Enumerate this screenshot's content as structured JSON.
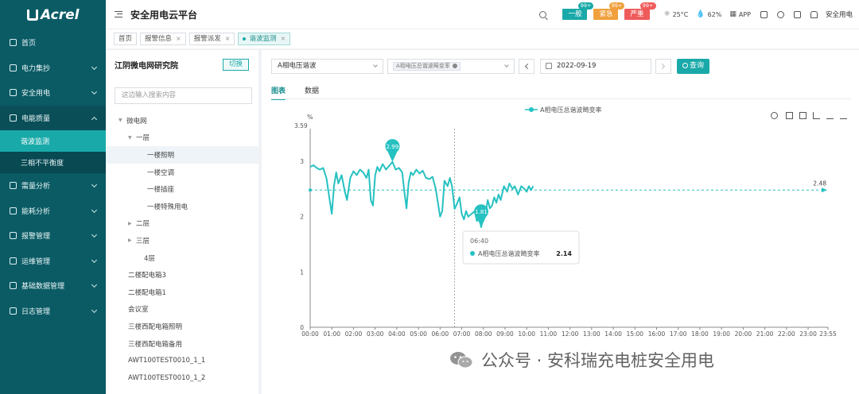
{
  "sidebar": {
    "brand": "Acrel",
    "items": [
      {
        "label": "首页",
        "icon": "home-icon"
      },
      {
        "label": "电力集抄",
        "icon": "meter-icon",
        "chevron": true
      },
      {
        "label": "安全用电",
        "icon": "flame-icon",
        "chevron": true
      },
      {
        "label": "电能质量",
        "icon": "monitor-icon",
        "chevron": true,
        "open": true
      },
      {
        "label": "需量分析",
        "icon": "trend-icon",
        "chevron": true
      },
      {
        "label": "能耗分析",
        "icon": "bar-chart-icon",
        "chevron": true
      },
      {
        "label": "报警管理",
        "icon": "alarm-icon",
        "chevron": true
      },
      {
        "label": "运维管理",
        "icon": "pulse-icon",
        "chevron": true
      },
      {
        "label": "基础数据管理",
        "icon": "database-icon",
        "chevron": true
      },
      {
        "label": "日志管理",
        "icon": "log-icon",
        "chevron": true
      }
    ],
    "sub_items": [
      {
        "label": "谐波监测",
        "active": true
      },
      {
        "label": "三相不平衡度",
        "active": false
      }
    ]
  },
  "header": {
    "title": "安全用电云平台",
    "alarms": [
      {
        "label": "一般",
        "count": "99+",
        "color": "#1aa9a9"
      },
      {
        "label": "紧急",
        "count": "99+",
        "color": "#f0a03c"
      },
      {
        "label": "严重",
        "count": "99+",
        "color": "#ef5b5b"
      }
    ],
    "temperature": "25°C",
    "humidity": "62%",
    "app_label": "APP",
    "user": "安全用电"
  },
  "tabs": [
    {
      "label": "首页",
      "closable": false,
      "active": false
    },
    {
      "label": "报警信息",
      "closable": true,
      "active": false
    },
    {
      "label": "报警派发",
      "closable": true,
      "active": false
    },
    {
      "label": "谐波监测",
      "closable": true,
      "active": true
    }
  ],
  "tree_panel": {
    "title": "江阴微电网研究院",
    "switch_label": "切换",
    "search_placeholder": "这边输入搜索内容",
    "nodes": [
      {
        "label": "微电网",
        "level": 0,
        "arrow": "down"
      },
      {
        "label": "一层",
        "level": 1,
        "arrow": "down"
      },
      {
        "label": "一楼照明",
        "level": 2,
        "selected": true
      },
      {
        "label": "一楼空调",
        "level": 2
      },
      {
        "label": "一楼插座",
        "level": 2
      },
      {
        "label": "一楼特殊用电",
        "level": 2
      },
      {
        "label": "二层",
        "level": 1,
        "arrow": "right"
      },
      {
        "label": "三层",
        "level": 1,
        "arrow": "right"
      },
      {
        "label": "4层",
        "level": 1
      },
      {
        "label": "二楼配电箱3",
        "level": -1
      },
      {
        "label": "二楼配电箱1",
        "level": -1
      },
      {
        "label": "会议室",
        "level": -1
      },
      {
        "label": "三楼西配电箱照明",
        "level": -1
      },
      {
        "label": "三楼西配电箱备用",
        "level": -1
      },
      {
        "label": "AWT100TEST0010_1_1",
        "level": -1
      },
      {
        "label": "AWT100TEST0010_1_2",
        "level": -1
      }
    ]
  },
  "toolbar": {
    "param_select": "A相电压谐波",
    "metric_chip": "A相电压总谐波畸变率",
    "date": "2022-09-19",
    "query_label": "查询"
  },
  "view_tabs": [
    {
      "label": "图表",
      "active": true
    },
    {
      "label": "数据",
      "active": false
    }
  ],
  "chart_data": {
    "type": "line",
    "legend": "A相电压总谐波畸变率",
    "y_unit": "%",
    "y_max_label": "3.59",
    "ylim": [
      0,
      3.59
    ],
    "yticks": [
      0,
      1,
      2,
      3
    ],
    "x_labels": [
      "00:00",
      "01:00",
      "02:00",
      "03:00",
      "04:00",
      "05:00",
      "06:00",
      "07:00",
      "08:00",
      "09:00",
      "10:00",
      "11:00",
      "12:00",
      "13:00",
      "14:00",
      "15:00",
      "16:00",
      "17:00",
      "18:00",
      "19:00",
      "20:00",
      "21:00",
      "22:00",
      "23:00",
      "23:55"
    ],
    "max_marker": {
      "value": "2.99",
      "time_hours": 3.8
    },
    "min_marker": {
      "value": "1.81",
      "time_hours": 7.9
    },
    "average_line": {
      "value": "2.48"
    },
    "tooltip": {
      "time": "06:40",
      "series": "A相电压总谐波畸变率",
      "value": "2.14",
      "time_hours": 6.67
    },
    "series": [
      {
        "name": "A相电压总谐波畸变率",
        "color": "#26c1c1",
        "points": [
          [
            0.0,
            2.9
          ],
          [
            0.15,
            2.93
          ],
          [
            0.3,
            2.88
          ],
          [
            0.45,
            2.85
          ],
          [
            0.6,
            2.88
          ],
          [
            0.75,
            2.7
          ],
          [
            0.9,
            2.3
          ],
          [
            1.0,
            2.05
          ],
          [
            1.1,
            2.55
          ],
          [
            1.2,
            2.8
          ],
          [
            1.3,
            2.6
          ],
          [
            1.45,
            2.75
          ],
          [
            1.6,
            2.45
          ],
          [
            1.7,
            2.3
          ],
          [
            1.85,
            2.7
          ],
          [
            2.0,
            2.82
          ],
          [
            2.15,
            2.75
          ],
          [
            2.3,
            2.85
          ],
          [
            2.45,
            2.8
          ],
          [
            2.6,
            2.7
          ],
          [
            2.7,
            2.85
          ],
          [
            2.8,
            2.3
          ],
          [
            2.9,
            2.2
          ],
          [
            3.0,
            2.75
          ],
          [
            3.1,
            2.9
          ],
          [
            3.2,
            2.82
          ],
          [
            3.35,
            2.95
          ],
          [
            3.5,
            2.85
          ],
          [
            3.65,
            2.92
          ],
          [
            3.8,
            2.99
          ],
          [
            3.95,
            2.85
          ],
          [
            4.1,
            2.88
          ],
          [
            4.25,
            2.8
          ],
          [
            4.35,
            2.45
          ],
          [
            4.45,
            2.15
          ],
          [
            4.55,
            2.62
          ],
          [
            4.65,
            2.8
          ],
          [
            4.75,
            2.75
          ],
          [
            4.9,
            2.85
          ],
          [
            5.05,
            2.78
          ],
          [
            5.2,
            2.83
          ],
          [
            5.35,
            2.7
          ],
          [
            5.5,
            2.68
          ],
          [
            5.65,
            2.72
          ],
          [
            5.8,
            2.5
          ],
          [
            5.9,
            2.25
          ],
          [
            6.0,
            2.0
          ],
          [
            6.1,
            2.1
          ],
          [
            6.2,
            2.65
          ],
          [
            6.35,
            2.55
          ],
          [
            6.45,
            2.7
          ],
          [
            6.55,
            2.55
          ],
          [
            6.67,
            2.14
          ],
          [
            6.8,
            2.25
          ],
          [
            6.9,
            2.35
          ],
          [
            7.0,
            2.05
          ],
          [
            7.1,
            1.95
          ],
          [
            7.2,
            2.1
          ],
          [
            7.3,
            2.0
          ],
          [
            7.45,
            2.05
          ],
          [
            7.6,
            2.1
          ],
          [
            7.7,
            1.92
          ],
          [
            7.8,
            2.0
          ],
          [
            7.9,
            1.81
          ],
          [
            8.0,
            2.0
          ],
          [
            8.1,
            2.05
          ],
          [
            8.2,
            2.3
          ],
          [
            8.3,
            2.15
          ],
          [
            8.4,
            2.2
          ],
          [
            8.5,
            2.35
          ],
          [
            8.6,
            2.25
          ],
          [
            8.7,
            2.4
          ],
          [
            8.8,
            2.3
          ],
          [
            8.95,
            2.55
          ],
          [
            9.1,
            2.45
          ],
          [
            9.2,
            2.6
          ],
          [
            9.35,
            2.5
          ],
          [
            9.45,
            2.55
          ],
          [
            9.6,
            2.4
          ],
          [
            9.75,
            2.55
          ],
          [
            9.9,
            2.5
          ],
          [
            10.0,
            2.45
          ],
          [
            10.1,
            2.55
          ],
          [
            10.2,
            2.48
          ],
          [
            10.3,
            2.55
          ]
        ]
      }
    ]
  },
  "watermark": "公众号 · 安科瑞充电桩安全用电"
}
